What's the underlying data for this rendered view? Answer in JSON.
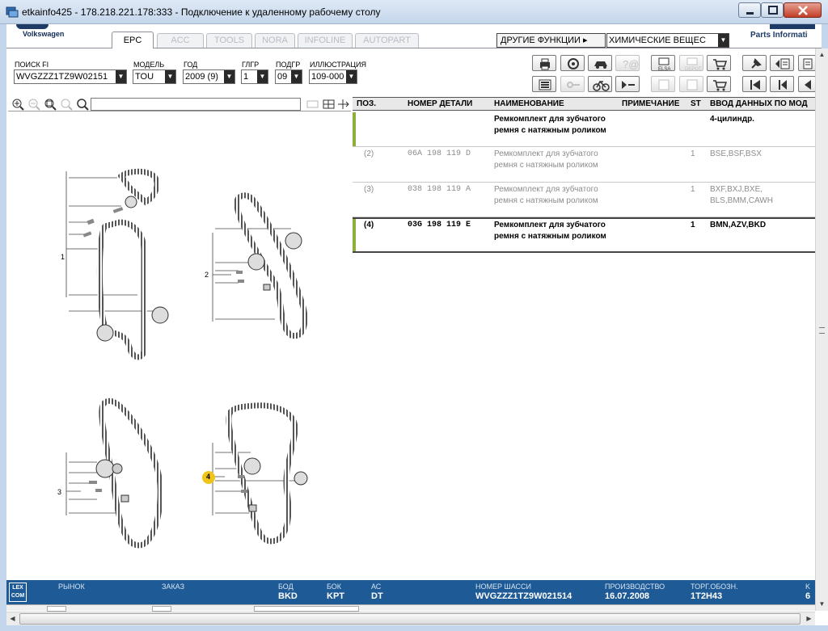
{
  "window": {
    "title": "etkainfo425 - 178.218.221.178:333 - Подключение к удаленному рабочему столу"
  },
  "header": {
    "brand": "Volkswagen",
    "parts_info": "Parts Informati",
    "tabs": [
      {
        "label": "EPC",
        "active": true
      },
      {
        "label": "ACC",
        "active": false
      },
      {
        "label": "TOOLS",
        "active": false
      },
      {
        "label": "NORA",
        "active": false
      },
      {
        "label": "INFOLINE",
        "active": false
      },
      {
        "label": "AUTOPART",
        "active": false
      }
    ],
    "other_functions": "ДРУГИЕ ФУНКЦИИ ▸",
    "chemicals": "ХИМИЧЕСКИЕ ВЕЩЕС"
  },
  "filters": {
    "search_fi": {
      "label": "ПОИСК FI",
      "value": "WVGZZZ1TZ9W02151"
    },
    "model": {
      "label": "МОДЕЛЬ",
      "value": "TOU"
    },
    "year": {
      "label": "ГОД",
      "value": "2009 (9)"
    },
    "main_group": {
      "label": "ГЛГР",
      "value": "1"
    },
    "sub_group": {
      "label": "ПОДГР",
      "value": "09"
    },
    "illustration": {
      "label": "ИЛЛЮСТРАЦИЯ",
      "value": "109-000"
    }
  },
  "toolbar_icons": {
    "elsa_label": "ELSA",
    "depot_label": "DEPOT"
  },
  "illustration": {
    "callouts": [
      "1",
      "2",
      "3",
      "4"
    ],
    "selected_callout": "4"
  },
  "parts_table": {
    "columns": [
      "ПОЗ.",
      "НОМЕР ДЕТАЛИ",
      "НАИМЕНОВАНИЕ",
      "ПРИМЕЧАНИЕ",
      "ST",
      "ВВОД ДАННЫХ ПО МОД"
    ],
    "rows": [
      {
        "pos": "",
        "part": "",
        "name1": "Ремкомплект для зубчатого",
        "name2": "ремня с натяжным роликом",
        "note": "",
        "st": "",
        "input1": "4-цилиндр.",
        "input2": "",
        "style": "bold",
        "mark": true
      },
      {
        "pos": "(2)",
        "part": "06A 198 119 D",
        "name1": "Ремкомплект для зубчатого",
        "name2": "ремня с натяжным роликом",
        "note": "",
        "st": "1",
        "input1": "BSE,BSF,BSX",
        "input2": "",
        "style": "grey",
        "mark": false
      },
      {
        "pos": "(3)",
        "part": "038 198 119 A",
        "name1": "Ремкомплект для зубчатого",
        "name2": "ремня с натяжным роликом",
        "note": "",
        "st": "1",
        "input1": "BXF,BXJ,BXE,",
        "input2": "BLS,BMM,CAWH",
        "style": "grey",
        "mark": false
      },
      {
        "pos": "(4)",
        "part": "03G 198 119 E",
        "name1": "Ремкомплект для зубчатого",
        "name2": "ремня с натяжным роликом",
        "note": "",
        "st": "1",
        "input1": "BMN,AZV,BKD",
        "input2": "",
        "style": "bold",
        "mark": true
      }
    ]
  },
  "status": {
    "logo": "LEX COM",
    "market_label": "РЫНОК",
    "order_label": "ЗАКАЗ",
    "bod_label": "БОД",
    "bod_value": "BKD",
    "bok_label": "БОК",
    "bok_value": "KPT",
    "ac_label": "АС",
    "ac_value": "DT",
    "chassis_label": "НОМЕР ШАССИ",
    "chassis_value": "WVGZZZ1TZ9W021514",
    "production_label": "ПРОИЗВОДСТВО",
    "production_value": "16.07.2008",
    "trade_label": "ТОРГ.ОБОЗН.",
    "trade_value": "1T2H43",
    "extra_label": "K",
    "extra_value": "6"
  },
  "colors": {
    "title_bar": "#c4d6ec",
    "status_bar": "#1e5a96",
    "row_marker": "#8fae3a",
    "callout_highlight": "#f0c419",
    "close_button": "#c43e28"
  }
}
